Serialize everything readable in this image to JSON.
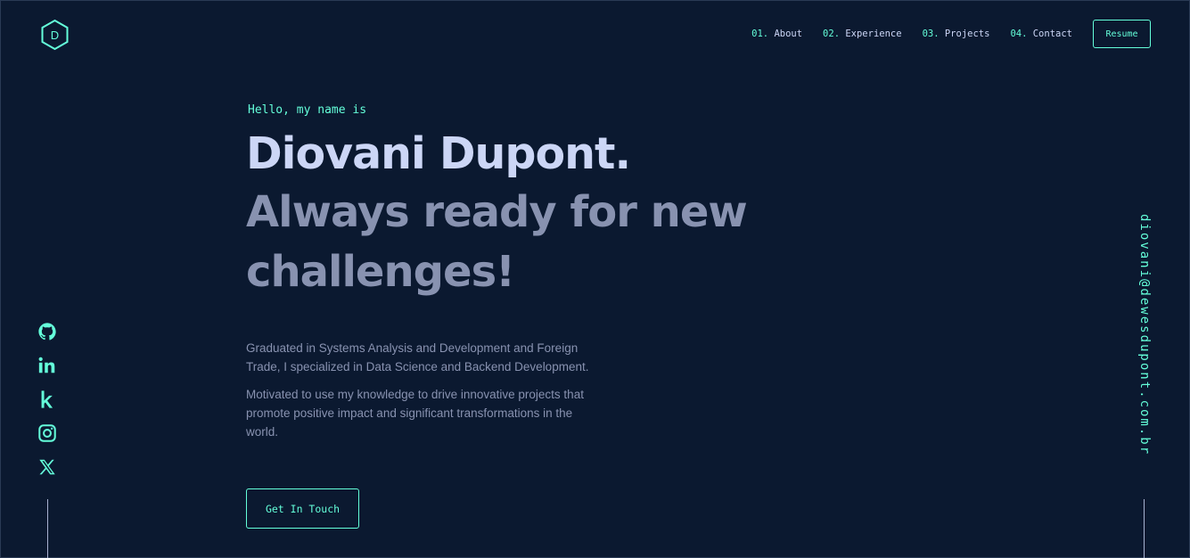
{
  "logo": {
    "letter": "D"
  },
  "nav": {
    "items": [
      {
        "num": "01.",
        "label": "About"
      },
      {
        "num": "02.",
        "label": "Experience"
      },
      {
        "num": "03.",
        "label": "Projects"
      },
      {
        "num": "04.",
        "label": "Contact"
      }
    ],
    "resume_label": "Resume"
  },
  "hero": {
    "greeting": "Hello, my name is",
    "name": "Diovani Dupont.",
    "tagline": "Always ready for new challenges!",
    "paragraphs": [
      "Graduated in Systems Analysis and Development and Foreign Trade, I specialized in Data Science and Backend Development.",
      "Motivated to use my knowledge to drive innovative projects that promote positive impact and significant transformations in the world."
    ],
    "cta_label": "Get In Touch"
  },
  "socials": [
    "github-icon",
    "linkedin-icon",
    "kaggle-icon",
    "instagram-icon",
    "x-icon"
  ],
  "email": "diovani@dewesdupont.com.br",
  "colors": {
    "background": "#0b1930",
    "accent": "#64ffda",
    "heading": "#ccd6f6",
    "text": "#8892b0"
  }
}
